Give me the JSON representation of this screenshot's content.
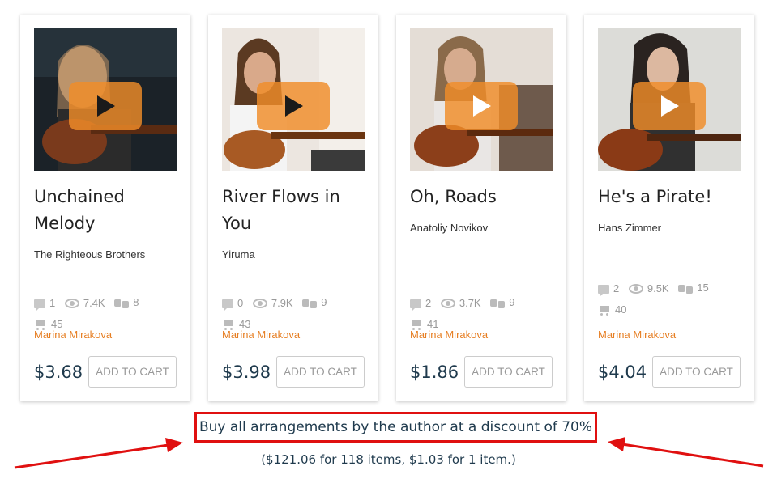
{
  "products": [
    {
      "title": "Unchained Melody",
      "artist": "The Righteous Brothers",
      "comments": "1",
      "views": "7.4K",
      "likes": "8",
      "purchases": "45",
      "author": "Marina Mirakova",
      "price": "$3.68",
      "add_to_cart": "ADD TO CART"
    },
    {
      "title": "River Flows in You",
      "artist": "Yiruma",
      "comments": "0",
      "views": "7.9K",
      "likes": "9",
      "purchases": "43",
      "author": "Marina Mirakova",
      "price": "$3.98",
      "add_to_cart": "ADD TO CART"
    },
    {
      "title": "Oh, Roads",
      "artist": "Anatoliy Novikov",
      "comments": "2",
      "views": "3.7K",
      "likes": "9",
      "purchases": "41",
      "author": "Marina Mirakova",
      "price": "$1.86",
      "add_to_cart": "ADD TO CART"
    },
    {
      "title": "He's a Pirate!",
      "artist": "Hans Zimmer",
      "comments": "2",
      "views": "9.5K",
      "likes": "15",
      "purchases": "40",
      "author": "Marina Mirakova",
      "price": "$4.04",
      "add_to_cart": "ADD TO CART"
    }
  ],
  "discount": {
    "label": "Buy all arrangements by the author at a discount of 70%",
    "details": "($121.06 for 118 items, $1.03 for 1 item.)"
  },
  "colors": {
    "author_link": "#e67e22",
    "price": "#1f3a4d",
    "highlight_box": "#e01010",
    "play_button": "#f08c28"
  }
}
